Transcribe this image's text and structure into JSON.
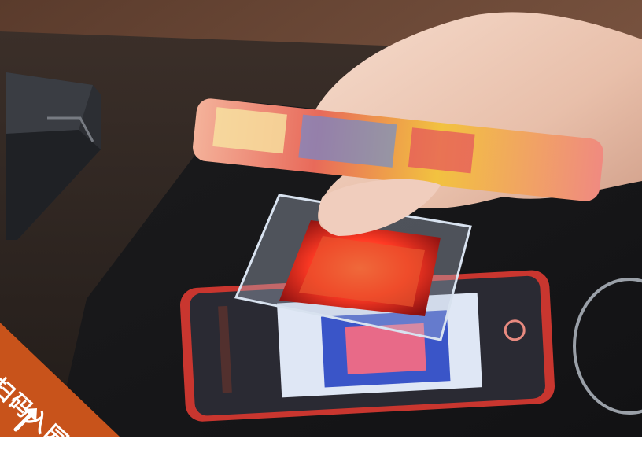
{
  "photo": {
    "scene": "hand-scanning-phone-qr-code-at-gate-reader",
    "colors": {
      "table": "#2a2420",
      "background_wall": "#6b4a36",
      "scanner_glow": "#ff4a2a",
      "badge": "#c8531b"
    }
  },
  "badge": {
    "text": "扫码入园",
    "icon": "arrow-up-right-icon"
  }
}
